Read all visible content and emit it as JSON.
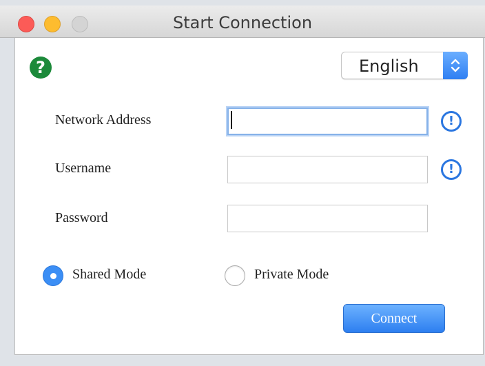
{
  "window": {
    "title": "Start Connection"
  },
  "language": {
    "selected": "English"
  },
  "form": {
    "network_address_label": "Network Address",
    "network_address_value": "",
    "username_label": "Username",
    "username_value": "",
    "password_label": "Password",
    "password_value": ""
  },
  "icons": {
    "help": "?",
    "warning": "!"
  },
  "mode": {
    "shared_label": "Shared Mode",
    "private_label": "Private Mode",
    "selected": "Shared Mode"
  },
  "actions": {
    "connect_label": "Connect"
  },
  "colors": {
    "accent": "#2f7ff2",
    "help_green": "#1c8a3a",
    "close": "#fc5b57",
    "minimize": "#fdbc2f",
    "maximize_disabled": "#d4d4d4"
  }
}
